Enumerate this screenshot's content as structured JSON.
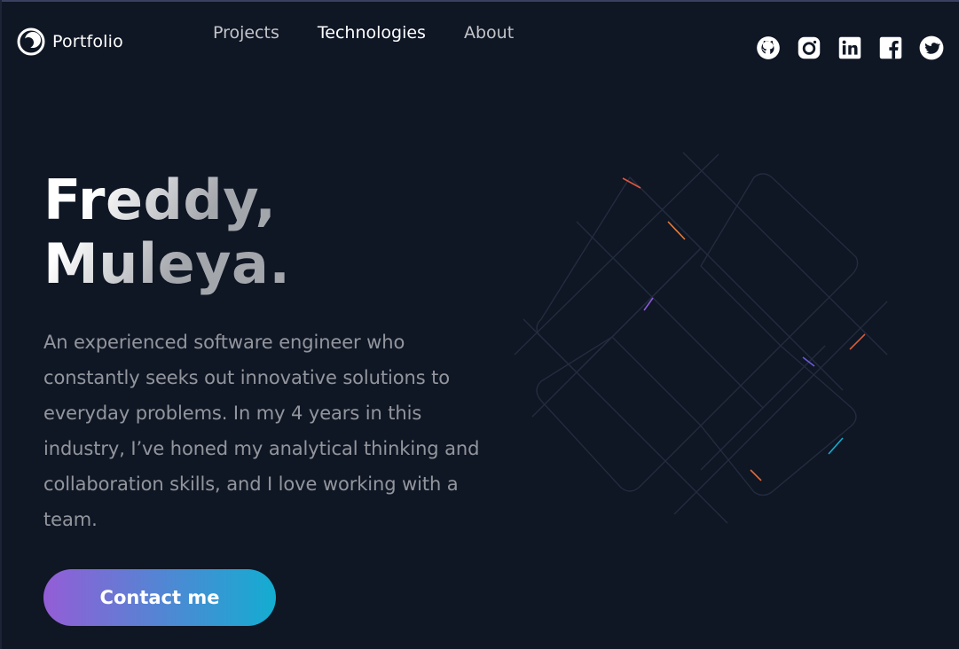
{
  "header": {
    "logo_text": "Portfolio",
    "nav": [
      {
        "label": "Projects",
        "active": false
      },
      {
        "label": "Technologies",
        "active": true
      },
      {
        "label": "About",
        "active": false
      }
    ],
    "socials": [
      {
        "icon": "github-icon"
      },
      {
        "icon": "instagram-icon"
      },
      {
        "icon": "linkedin-icon"
      },
      {
        "icon": "facebook-icon"
      },
      {
        "icon": "twitter-icon"
      }
    ]
  },
  "hero": {
    "title_line1": "Freddy,",
    "title_line2": "Muleya.",
    "description": "An experienced software engineer who constantly seeks out innovative solutions to everyday problems. In my 4 years in this industry, I’ve honed my analytical thinking and collaboration skills, and I love working with a team.",
    "cta_label": "Contact me"
  },
  "colors": {
    "background": "#0f1624",
    "gradient_start": "#945dd6",
    "gradient_end": "#13add1",
    "text": "#ffffff"
  }
}
